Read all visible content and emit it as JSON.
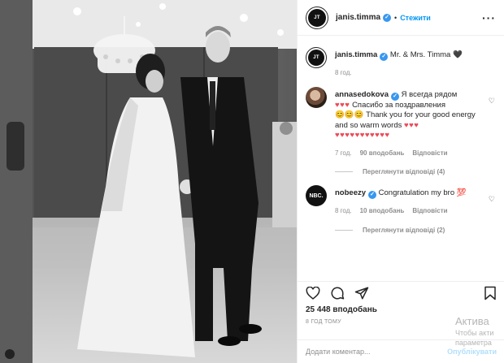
{
  "post": {
    "username": "janis.timma",
    "avatar_text": "JT",
    "follow_label": "Стежити",
    "caption": "Mr. & Mrs. Timma 🖤",
    "caption_time": "8 год.",
    "likes": "25 448 вподобань",
    "posted": "8 ГОД ТОМУ"
  },
  "comments": [
    {
      "username": "annasedokova",
      "text_1": "Я всегда рядом",
      "hearts_1": "♥♥♥",
      "text_2": "Спасибо за поздравления",
      "emoji_2": "😊😊😊",
      "text_3": "Thank you for your good energy and so warm words",
      "hearts_3": "♥♥♥",
      "hearts_4": "♥♥♥♥♥♥♥♥♥♥♥",
      "time": "7 год.",
      "likes": "90 вподобань",
      "reply": "Відповісти",
      "view_replies": "Переглянути відповіді (4)"
    },
    {
      "username": "nobeezy",
      "avatar_text": "NBC.",
      "text": "Congratulation my bro 💯",
      "time": "8 год.",
      "likes": "10 вподобань",
      "reply": "Відповісти",
      "view_replies": "Переглянути відповіді (2)"
    }
  ],
  "add_comment": {
    "placeholder": "Додати коментар...",
    "publish": "Опублікувати"
  },
  "watermark": {
    "line1": "Актива",
    "line2": "Чтобы акти",
    "line3": "параметра"
  },
  "icons": [
    "heart-icon",
    "comment-icon",
    "share-icon",
    "bookmark-icon",
    "more-icon",
    "verified-icon"
  ],
  "colors": {
    "accent": "#0095f6",
    "verified": "#3897f0",
    "heart": "#ed4956"
  }
}
